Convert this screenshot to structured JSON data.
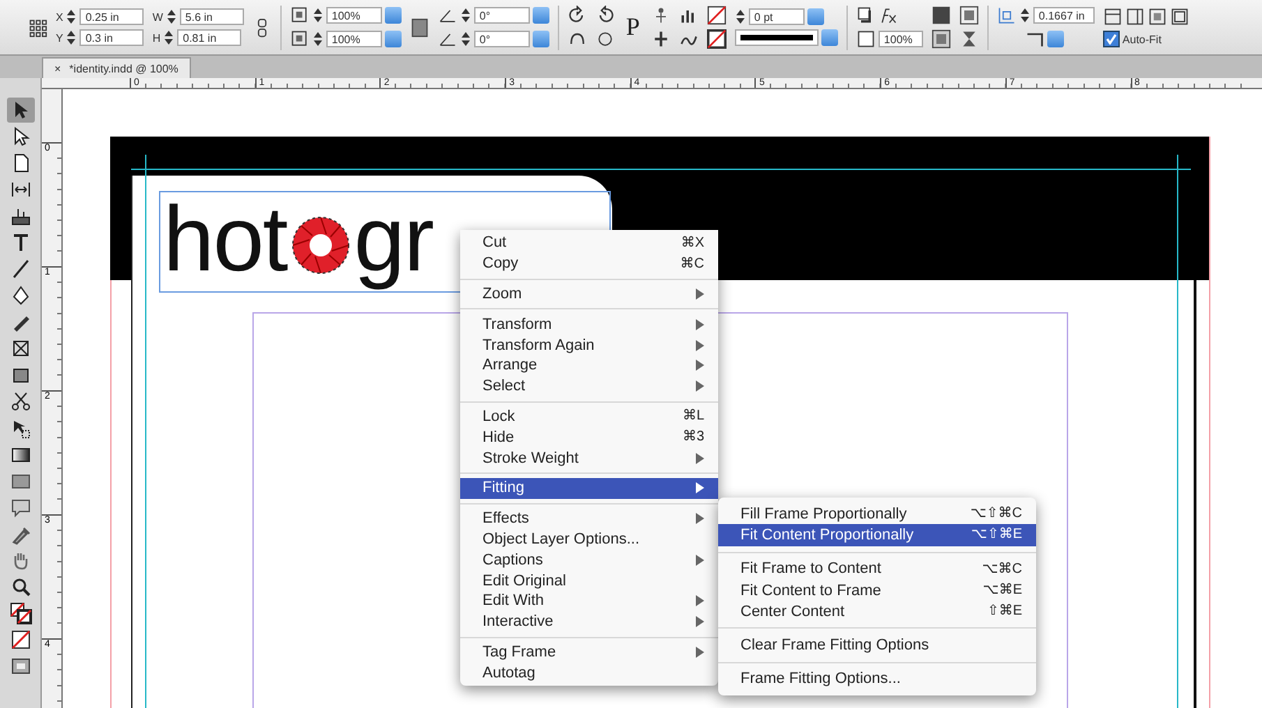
{
  "control_bar": {
    "position_fields": [
      {
        "label": "X",
        "value": "0.25 in"
      },
      {
        "label": "Y",
        "value": "0.3 in"
      }
    ],
    "size_fields": [
      {
        "label": "W",
        "value": "5.6 in"
      },
      {
        "label": "H",
        "value": "0.81 in"
      }
    ],
    "scale_fields": [
      {
        "value": "100%"
      },
      {
        "value": "100%"
      }
    ],
    "angle_fields": [
      {
        "value": "0°"
      },
      {
        "value": "0°"
      }
    ],
    "text_wrap_label": "P",
    "stroke_weight": "0 pt",
    "opacity": "100%",
    "gutter": "0.1667 in",
    "auto_fit": {
      "label": "Auto-Fit",
      "checked": true
    }
  },
  "document_tab": {
    "close": "×",
    "title": "*identity.indd @ 100%",
    "selected": true
  },
  "ruler": {
    "horizontal": [
      "0",
      "1",
      "2",
      "3",
      "4",
      "5",
      "6",
      "7",
      "8"
    ],
    "vertical": [
      "0",
      "1",
      "2",
      "3",
      "4"
    ]
  },
  "tools": [
    {
      "kind": "selection",
      "selected": true
    },
    {
      "kind": "direct",
      "selected": false
    },
    {
      "kind": "page",
      "selected": false
    },
    {
      "kind": "gap",
      "selected": false
    },
    {
      "kind": "collector",
      "selected": false
    },
    {
      "kind": "type",
      "selected": false
    },
    {
      "kind": "line",
      "selected": false
    },
    {
      "kind": "pen",
      "selected": false
    },
    {
      "kind": "pencil",
      "selected": false
    },
    {
      "kind": "frame",
      "selected": false
    },
    {
      "kind": "rect",
      "selected": false
    },
    {
      "kind": "scissors",
      "selected": false
    },
    {
      "kind": "transform",
      "selected": false
    },
    {
      "kind": "gradient",
      "selected": false
    },
    {
      "kind": "feather",
      "selected": false
    },
    {
      "kind": "note",
      "selected": false
    },
    {
      "kind": "eyedropper",
      "selected": false
    },
    {
      "kind": "hand",
      "selected": false
    },
    {
      "kind": "zoom",
      "selected": false
    },
    {
      "kind": "fillstroke",
      "selected": false
    },
    {
      "kind": "none",
      "selected": false
    },
    {
      "kind": "view",
      "selected": false
    }
  ],
  "canvas": {
    "logo": {
      "before": "hot",
      "after": "gr"
    }
  },
  "context_menu": {
    "items": [
      {
        "kind": "item",
        "label": "Cut",
        "shortcut": "⌘X",
        "submenu": false,
        "selected": false
      },
      {
        "kind": "item",
        "label": "Copy",
        "shortcut": "⌘C",
        "submenu": false,
        "selected": false
      },
      {
        "kind": "separator"
      },
      {
        "kind": "item",
        "label": "Zoom",
        "submenu": true,
        "selected": false
      },
      {
        "kind": "separator"
      },
      {
        "kind": "item",
        "label": "Transform",
        "submenu": true,
        "selected": false
      },
      {
        "kind": "item",
        "label": "Transform Again",
        "submenu": true,
        "selected": false
      },
      {
        "kind": "item",
        "label": "Arrange",
        "submenu": true,
        "selected": false
      },
      {
        "kind": "item",
        "label": "Select",
        "submenu": true,
        "selected": false
      },
      {
        "kind": "separator"
      },
      {
        "kind": "item",
        "label": "Lock",
        "shortcut": "⌘L",
        "submenu": false,
        "selected": false
      },
      {
        "kind": "item",
        "label": "Hide",
        "shortcut": "⌘3",
        "submenu": false,
        "selected": false
      },
      {
        "kind": "item",
        "label": "Stroke Weight",
        "submenu": true,
        "selected": false
      },
      {
        "kind": "separator"
      },
      {
        "kind": "item",
        "label": "Fitting",
        "submenu": true,
        "selected": true
      },
      {
        "kind": "separator"
      },
      {
        "kind": "item",
        "label": "Effects",
        "submenu": true,
        "selected": false
      },
      {
        "kind": "item",
        "label": "Object Layer Options...",
        "submenu": false,
        "selected": false
      },
      {
        "kind": "item",
        "label": "Captions",
        "submenu": true,
        "selected": false
      },
      {
        "kind": "item",
        "label": "Edit Original",
        "submenu": false,
        "selected": false
      },
      {
        "kind": "item",
        "label": "Edit With",
        "submenu": true,
        "selected": false
      },
      {
        "kind": "item",
        "label": "Interactive",
        "submenu": true,
        "selected": false
      },
      {
        "kind": "separator"
      },
      {
        "kind": "item",
        "label": "Tag Frame",
        "submenu": true,
        "selected": false
      },
      {
        "kind": "item",
        "label": "Autotag",
        "submenu": false,
        "selected": false
      }
    ]
  },
  "submenu": {
    "items": [
      {
        "kind": "item",
        "label": "Fill Frame Proportionally",
        "shortcut": "⌥⇧⌘C",
        "submenu": false,
        "selected": false
      },
      {
        "kind": "item",
        "label": "Fit Content Proportionally",
        "shortcut": "⌥⇧⌘E",
        "submenu": false,
        "selected": true
      },
      {
        "kind": "separator"
      },
      {
        "kind": "item",
        "label": "Fit Frame to Content",
        "shortcut": "⌥⌘C",
        "submenu": false,
        "selected": false
      },
      {
        "kind": "item",
        "label": "Fit Content to Frame",
        "shortcut": "⌥⌘E",
        "submenu": false,
        "selected": false
      },
      {
        "kind": "item",
        "label": "Center Content",
        "shortcut": "⇧⌘E",
        "submenu": false,
        "selected": false
      },
      {
        "kind": "separator"
      },
      {
        "kind": "item",
        "label": "Clear Frame Fitting Options",
        "submenu": false,
        "selected": false
      },
      {
        "kind": "separator"
      },
      {
        "kind": "item",
        "label": "Frame Fitting Options...",
        "submenu": false,
        "selected": false
      }
    ]
  }
}
